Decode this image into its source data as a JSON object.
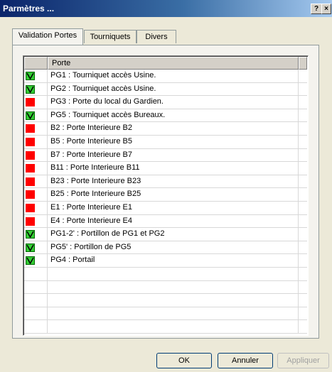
{
  "window": {
    "title": "Parmètres ...",
    "help_label": "?",
    "close_label": "×"
  },
  "tabs": [
    {
      "label": "Validation Portes",
      "active": true
    },
    {
      "label": "Tourniquets",
      "active": false
    },
    {
      "label": "Divers",
      "active": false
    }
  ],
  "list": {
    "column_header": "Porte",
    "rows": [
      {
        "label": "PG1 : Tourniquet accès Usine.",
        "status": "ok"
      },
      {
        "label": "PG2 : Tourniquet accès Usine.",
        "status": "ok"
      },
      {
        "label": "PG3 : Porte du local du Gardien.",
        "status": "ko"
      },
      {
        "label": "PG5 : Tourniquet accès Bureaux.",
        "status": "ok"
      },
      {
        "label": "B2 : Porte Interieure B2",
        "status": "ko"
      },
      {
        "label": "B5 : Porte Interieure B5",
        "status": "ko"
      },
      {
        "label": "B7 : Porte Interieure B7",
        "status": "ko"
      },
      {
        "label": "B11 : Porte Interieure B11",
        "status": "ko"
      },
      {
        "label": "B23 : Porte Interieure B23",
        "status": "ko"
      },
      {
        "label": "B25 : Porte Interieure B25",
        "status": "ko"
      },
      {
        "label": "E1 : Porte Interieure E1",
        "status": "ko"
      },
      {
        "label": "E4 : Porte Interieure E4",
        "status": "ko"
      },
      {
        "label": "PG1-2' : Portillon de PG1 et PG2",
        "status": "ok"
      },
      {
        "label": "PG5' : Portillon de PG5",
        "status": "ok"
      },
      {
        "label": "PG4 : Portail",
        "status": "ok"
      },
      {
        "label": "",
        "status": ""
      },
      {
        "label": "",
        "status": ""
      },
      {
        "label": "",
        "status": ""
      },
      {
        "label": "",
        "status": ""
      },
      {
        "label": "",
        "status": ""
      }
    ]
  },
  "buttons": {
    "ok": "OK",
    "cancel": "Annuler",
    "apply": "Appliquer"
  },
  "colors": {
    "status_ok": "#33cc33",
    "status_ko": "#ff0000"
  }
}
